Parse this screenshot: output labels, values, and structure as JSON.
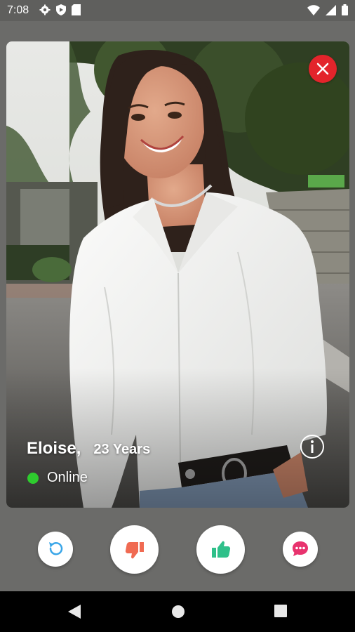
{
  "status_bar": {
    "time": "7:08",
    "icons_left": [
      "gear-icon",
      "shield-icon",
      "sim-card-icon"
    ],
    "icons_right": [
      "wifi-icon",
      "signal-icon",
      "battery-icon"
    ]
  },
  "profile": {
    "name": "Eloise,",
    "age": "23 Years",
    "status": "Online",
    "status_color": "#2ecc2e"
  },
  "actions": [
    "undo-icon",
    "thumbs-down-icon",
    "thumbs-up-icon",
    "chat-icon"
  ],
  "colors": {
    "close": "#e3242b",
    "undo": "#3aa6e8",
    "dislike": "#f06a52",
    "like": "#2fc08a",
    "chat": "#e8336e"
  },
  "nav": [
    "back-icon",
    "home-icon",
    "recents-icon"
  ]
}
